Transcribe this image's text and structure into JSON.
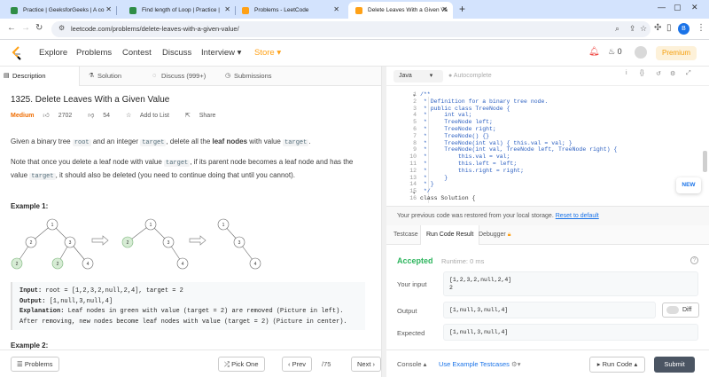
{
  "browser": {
    "tabs": [
      {
        "title": "Practice | GeeksforGeeks | A co",
        "color": "#2f8d46"
      },
      {
        "title": "Find length of Loop | Practice |",
        "color": "#2f8d46"
      },
      {
        "title": "Problems - LeetCode",
        "color": "#ffa116"
      },
      {
        "title": "Delete Leaves With a Given Va",
        "color": "#ffa116"
      }
    ],
    "url": "leetcode.com/problems/delete-leaves-with-a-given-value/",
    "profile_initial": "B"
  },
  "nav": {
    "links": [
      "Explore",
      "Problems",
      "Contest",
      "Discuss",
      "Interview ▾",
      "Store ▾"
    ],
    "notification_count": "0",
    "premium": "Premium"
  },
  "subtabs": [
    "Description",
    "Solution",
    "Discuss (999+)",
    "Submissions"
  ],
  "problem": {
    "title": "1325. Delete Leaves With a Given Value",
    "difficulty": "Medium",
    "likes": "2702",
    "dislikes": "54",
    "add_to_list": "Add to List",
    "share": "Share",
    "p1_a": "Given a binary tree ",
    "p1_root": "root",
    "p1_b": " and an integer ",
    "p1_target": "target",
    "p1_c": ", delete all the ",
    "p1_bold": "leaf nodes",
    "p1_d": " with value ",
    "p1_target2": "target",
    "p1_e": ".",
    "p2_a": "Note that once you delete a leaf node with value ",
    "p2_target": "target",
    "p2_b": ", if its parent node becomes a leaf node and has the value ",
    "p2_target2": "target",
    "p2_c": ", it should also be deleted (you need to continue doing that until you cannot).",
    "example1_title": "Example 1:",
    "example2_title": "Example 2:",
    "ex_input_label": "Input:",
    "ex_input": " root = [1,2,3,2,null,2,4], target = 2",
    "ex_output_label": "Output:",
    "ex_output": " [1,null,3,null,4]",
    "ex_expl_label": "Explanation:",
    "ex_expl": " Leaf nodes in green with value (target = 2) are removed (Picture in left).",
    "ex_expl2": "After removing, new nodes become leaf nodes with value (target = 2) (Picture in center).",
    "tree_labels": {
      "t1": [
        "1",
        "2",
        "3",
        "2",
        "2",
        "4"
      ],
      "t2": [
        "1",
        "2",
        "3",
        "4"
      ],
      "t3": [
        "1",
        "3",
        "4"
      ]
    },
    "highlight_color": "#d7ecd5"
  },
  "left_bottom": {
    "problems": "Problems",
    "pick_one": "Pick One",
    "prev": "Prev",
    "page": "/75",
    "next": "Next"
  },
  "editor": {
    "language": "Java",
    "autocomplete": "Autocomplete",
    "line_numbers": [
      "1",
      "2",
      "3",
      "4",
      "5",
      "6",
      "7",
      "8",
      "9",
      "10",
      "11",
      "12",
      "13",
      "14",
      "15",
      "16"
    ],
    "lines": [
      "/**",
      " * Definition for a binary tree node.",
      " * public class TreeNode {",
      " *     int val;",
      " *     TreeNode left;",
      " *     TreeNode right;",
      " *     TreeNode() {}",
      " *     TreeNode(int val) { this.val = val; }",
      " *     TreeNode(int val, TreeNode left, TreeNode right) {",
      " *         this.val = val;",
      " *         this.left = left;",
      " *         this.right = right;",
      " *     }",
      " * }",
      " */",
      "class Solution {"
    ],
    "new_badge": "NEW"
  },
  "restored": {
    "text": "Your previous code was restored from your local storage. ",
    "link": "Reset to default"
  },
  "result_tabs": [
    "Testcase",
    "Run Code Result",
    "Debugger"
  ],
  "result": {
    "status": "Accepted",
    "runtime": "Runtime: 0 ms",
    "your_input_label": "Your input",
    "your_input_line1": "[1,2,3,2,null,2,4]",
    "your_input_line2": "2",
    "output_label": "Output",
    "output": "[1,null,3,null,4]",
    "diff": "Diff",
    "expected_label": "Expected",
    "expected": "[1,null,3,null,4]"
  },
  "right_bottom": {
    "console": "Console ▴",
    "use_example": "Use Example Testcases",
    "run_code": "▸ Run Code ▴",
    "submit": "Submit"
  }
}
